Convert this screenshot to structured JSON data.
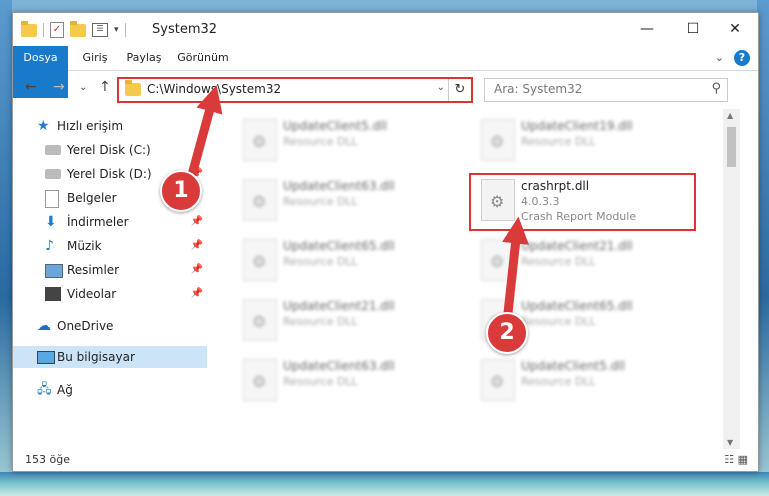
{
  "window": {
    "title": "System32",
    "controls": {
      "minimize": "—",
      "maximize": "☐",
      "close": "✕"
    }
  },
  "ribbon": {
    "tabs": [
      "Dosya",
      "Giriş",
      "Paylaş",
      "Görünüm"
    ],
    "help": "?"
  },
  "address": {
    "path": "C:\\Windows\\System32",
    "search_placeholder": "Ara: System32"
  },
  "sidebar": {
    "items": [
      {
        "label": "Hızlı erişim",
        "icon": "star-icon"
      },
      {
        "label": "Yerel Disk (C:)",
        "icon": "drive-icon"
      },
      {
        "label": "Yerel Disk (D:)",
        "icon": "drive-icon"
      },
      {
        "label": "Belgeler",
        "icon": "documents-icon"
      },
      {
        "label": "İndirmeler",
        "icon": "download-icon"
      },
      {
        "label": "Müzik",
        "icon": "music-icon"
      },
      {
        "label": "Resimler",
        "icon": "pictures-icon"
      },
      {
        "label": "Videolar",
        "icon": "video-icon"
      },
      {
        "label": "OneDrive",
        "icon": "cloud-icon"
      },
      {
        "label": "Bu bilgisayar",
        "icon": "computer-icon"
      },
      {
        "label": "Ağ",
        "icon": "network-icon"
      }
    ]
  },
  "files": [
    {
      "name": "UpdateClient5.dll",
      "desc": "Resource DLL"
    },
    {
      "name": "UpdateClient19.dll",
      "desc": "Resource DLL"
    },
    {
      "name": "UpdateClient63.dll",
      "desc": "Resource DLL"
    },
    {
      "name": "crashrpt.dll",
      "version": "4.0.3.3",
      "desc": "Crash Report Module"
    },
    {
      "name": "UpdateClient65.dll",
      "desc": "Resource DLL"
    },
    {
      "name": "UpdateClient21.dll",
      "desc": "Resource DLL"
    },
    {
      "name": "UpdateClient21.dll",
      "desc": "Resource DLL"
    },
    {
      "name": "UpdateClient65.dll",
      "desc": "Resource DLL"
    },
    {
      "name": "UpdateClient63.dll",
      "desc": "Resource DLL"
    },
    {
      "name": "UpdateClient5.dll",
      "desc": "Resource DLL"
    }
  ],
  "status": {
    "count": "153 öğe"
  },
  "annotations": {
    "step1": "1",
    "step2": "2",
    "color": "#d93a3a"
  }
}
